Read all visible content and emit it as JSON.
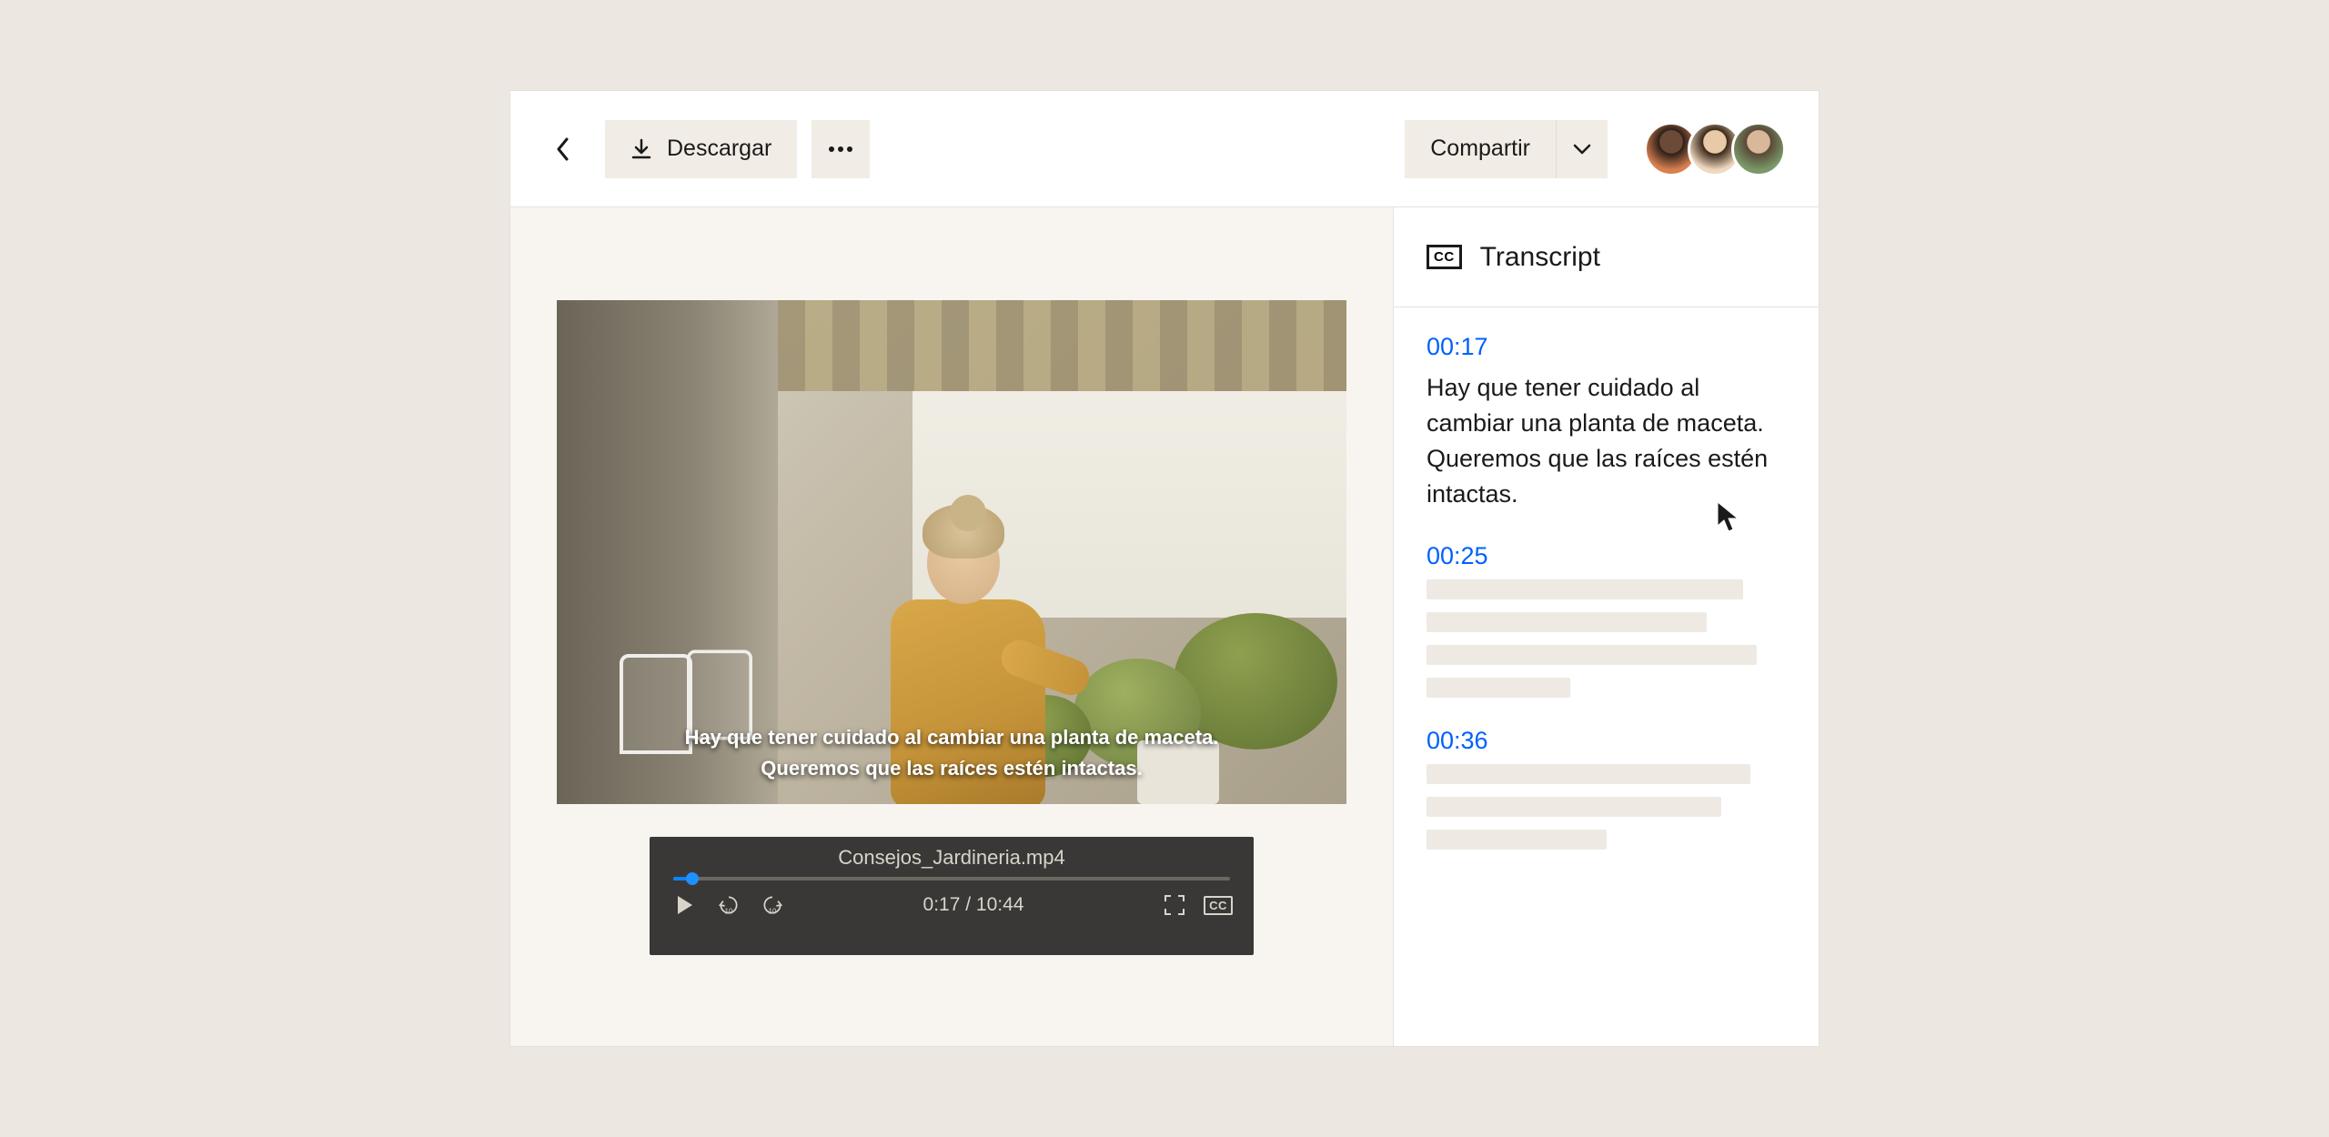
{
  "toolbar": {
    "download_label": "Descargar",
    "share_label": "Compartir"
  },
  "video": {
    "caption_line1": "Hay que tener cuidado al cambiar una planta de maceta.",
    "caption_line2": "Queremos que las raíces estén intactas."
  },
  "player": {
    "filename": "Consejos_Jardineria.mp4",
    "current_time": "0:17",
    "separator": " / ",
    "total_time": "10:44",
    "skip_label": "10"
  },
  "transcript": {
    "title": "Transcript",
    "cc_label": "CC",
    "entries": [
      {
        "time": "00:17",
        "text": "Hay que tener cuidado al cambiar una planta de maceta. Queremos que las raíces estén intactas."
      },
      {
        "time": "00:25"
      },
      {
        "time": "00:36"
      }
    ]
  }
}
